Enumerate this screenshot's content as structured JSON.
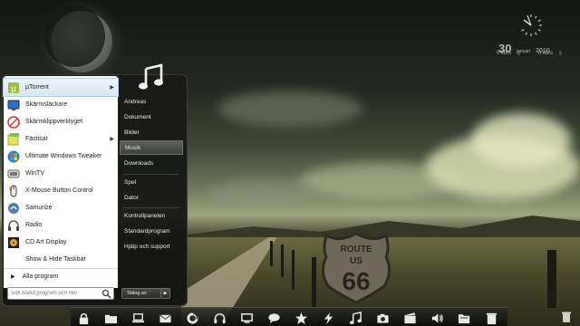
{
  "clock": {
    "day": "30",
    "month": "januari",
    "year": "2010"
  },
  "network": {
    "download": "0 kb/s",
    "upload": "0 kb/s"
  },
  "sign": {
    "top": "ROUTE",
    "middle": "US",
    "number": "66"
  },
  "start_menu": {
    "programs": [
      {
        "label": "µTorrent",
        "icon": "utorrent-icon",
        "submenu": true,
        "selected": true
      },
      {
        "label": "Skärmsläckare",
        "icon": "screensaver-icon",
        "submenu": false
      },
      {
        "label": "Skärmklippverktyget",
        "icon": "snipping-tool-icon",
        "submenu": false
      },
      {
        "label": "Fästisar",
        "icon": "sticky-notes-icon",
        "submenu": true
      },
      {
        "label": "Ultimate Windows Tweaker",
        "icon": "windows-tweaker-icon",
        "submenu": false
      },
      {
        "label": "WinTV",
        "icon": "tv-icon",
        "submenu": false
      },
      {
        "label": "X-Mouse Button Control",
        "icon": "mouse-icon",
        "submenu": false
      },
      {
        "label": "Samurize",
        "icon": "samurize-icon",
        "submenu": false
      },
      {
        "label": "Radio",
        "icon": "headphones-icon",
        "submenu": false
      },
      {
        "label": "CD Art Display",
        "icon": "cd-art-icon",
        "submenu": false
      },
      {
        "label": "Show & Hide Taskbar",
        "icon": "blank-icon",
        "submenu": false
      }
    ],
    "all_programs": "Alla program",
    "search_placeholder": "Sök bland program och filer",
    "places": [
      {
        "label": "Andreas",
        "active": false
      },
      {
        "label": "Dokument",
        "active": false
      },
      {
        "label": "Bilder",
        "active": false
      },
      {
        "label": "Musik",
        "active": true
      },
      {
        "label": "Downloads",
        "active": false
      },
      {
        "label": "Spel",
        "active": false
      },
      {
        "label": "Dator",
        "active": false
      },
      {
        "label": "Kontrollpanelen",
        "active": false
      },
      {
        "label": "Standardprogram",
        "active": false
      },
      {
        "label": "Hjälp och support",
        "active": false
      }
    ],
    "shutdown_label": "Stäng av"
  },
  "dock": {
    "items": [
      "lock-icon",
      "folder-icon",
      "laptop-icon",
      "mail-icon",
      "firefox-icon",
      "headphones-icon",
      "monitor-icon",
      "chat-bubble-icon",
      "star-icon",
      "lightning-icon",
      "music-note-icon",
      "camera-icon",
      "film-icon",
      "speaker-icon",
      "folder-open-icon",
      "trash-icon"
    ]
  }
}
